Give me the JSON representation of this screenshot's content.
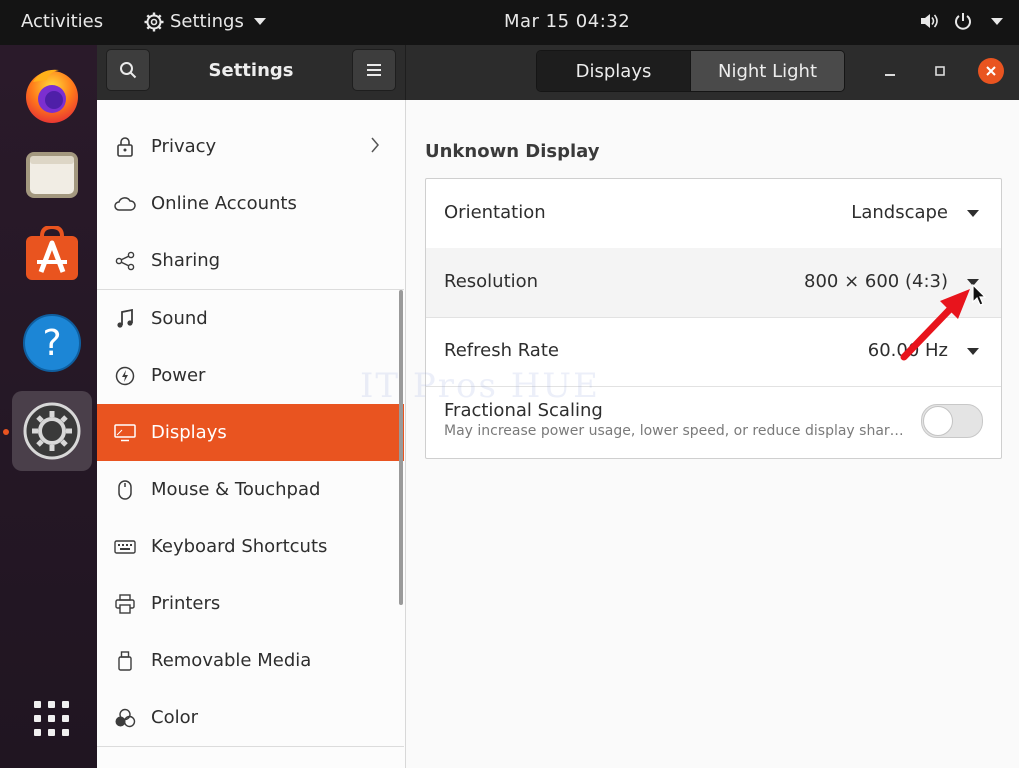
{
  "topbar": {
    "activities": "Activities",
    "app_menu": "Settings",
    "clock": "Mar 15  04:32"
  },
  "headerbar": {
    "title": "Settings",
    "tabs": [
      {
        "label": "Displays",
        "active": true
      },
      {
        "label": "Night Light",
        "active": false
      }
    ]
  },
  "dock": {
    "items": [
      {
        "icon": "firefox-icon"
      },
      {
        "icon": "files-icon"
      },
      {
        "icon": "software-icon"
      },
      {
        "icon": "help-icon"
      },
      {
        "icon": "settings-gear-icon",
        "active": true
      },
      {
        "icon": "show-apps-icon"
      }
    ]
  },
  "sidebar": {
    "items": [
      {
        "label": "Privacy",
        "icon": "lock-icon",
        "has_chevron": true
      },
      {
        "label": "Online Accounts",
        "icon": "cloud-icon"
      },
      {
        "label": "Sharing",
        "icon": "share-icon"
      },
      {
        "label": "Sound",
        "icon": "music-note-icon"
      },
      {
        "label": "Power",
        "icon": "power-icon"
      },
      {
        "label": "Displays",
        "icon": "monitor-icon",
        "selected": true
      },
      {
        "label": "Mouse & Touchpad",
        "icon": "mouse-icon"
      },
      {
        "label": "Keyboard Shortcuts",
        "icon": "keyboard-icon"
      },
      {
        "label": "Printers",
        "icon": "printer-icon"
      },
      {
        "label": "Removable Media",
        "icon": "usb-drive-icon"
      },
      {
        "label": "Color",
        "icon": "color-circles-icon"
      }
    ]
  },
  "main": {
    "section_title": "Unknown Display",
    "orientation": {
      "label": "Orientation",
      "value": "Landscape"
    },
    "resolution": {
      "label": "Resolution",
      "value": "800 × 600 (4:3)"
    },
    "refresh_rate": {
      "label": "Refresh Rate",
      "value": "60.00 Hz"
    },
    "fractional_scaling": {
      "label": "Fractional Scaling",
      "description": "May increase power usage, lower speed, or reduce display sharp…",
      "enabled": false
    }
  },
  "watermark": "IT Pros HUE",
  "colors": {
    "accent": "#e95420",
    "topbar": "#141414",
    "headerbar": "#2c2c2c",
    "dock": "#2a1a2a",
    "annotation_arrow": "#e8141c"
  }
}
